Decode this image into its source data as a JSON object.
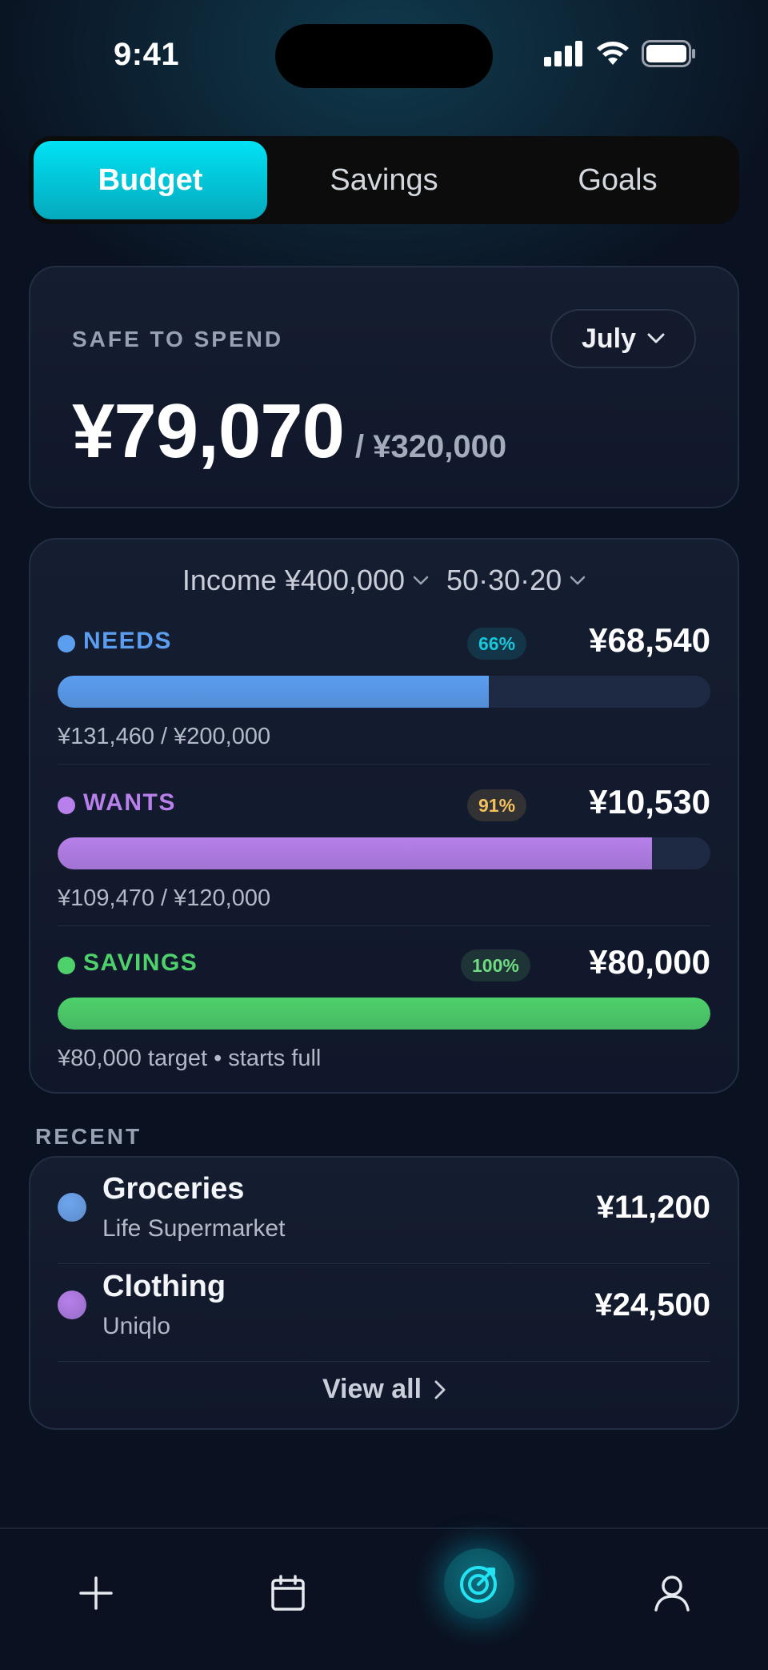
{
  "status_bar": {
    "time": "9:41"
  },
  "tabs": [
    {
      "label": "Budget",
      "active": true
    },
    {
      "label": "Savings",
      "active": false
    },
    {
      "label": "Goals",
      "active": false
    }
  ],
  "safe": {
    "label": "SAFE TO SPEND",
    "month": "July",
    "amount": "¥79,070",
    "total": "/ ¥320,000"
  },
  "budget": {
    "income": "Income ¥400,000",
    "rule": "50·30·20",
    "categories": [
      {
        "name": "NEEDS",
        "percent_label": "66%",
        "percent": 66,
        "amount": "¥68,540",
        "detail": "¥131,460 / ¥200,000",
        "color": "#5b9ef0",
        "badge_color": "#17c7dc"
      },
      {
        "name": "WANTS",
        "percent_label": "91%",
        "percent": 91,
        "amount": "¥10,530",
        "detail": "¥109,470 / ¥120,000",
        "color": "#b780ea",
        "badge_color": "#f2c15c"
      },
      {
        "name": "SAVINGS",
        "percent_label": "100%",
        "percent": 100,
        "amount": "¥80,000",
        "detail": "¥80,000 target • starts full",
        "color": "#4ed16a",
        "badge_color": "#6fdc82"
      }
    ]
  },
  "recent": {
    "label": "RECENT",
    "transactions": [
      {
        "title": "Groceries",
        "merchant": "Life Supermarket",
        "amount": "¥11,200",
        "color": "#6ea6ef"
      },
      {
        "title": "Clothing",
        "merchant": "Uniqlo",
        "amount": "¥24,500",
        "color": "#b780ea"
      }
    ],
    "view_all": "View all"
  },
  "bottom_nav": {
    "icons": [
      "plus-icon",
      "calendar-icon",
      "target-icon",
      "profile-icon"
    ]
  },
  "colors": {
    "accent": "#00d8ec",
    "background": "#0a1120"
  }
}
